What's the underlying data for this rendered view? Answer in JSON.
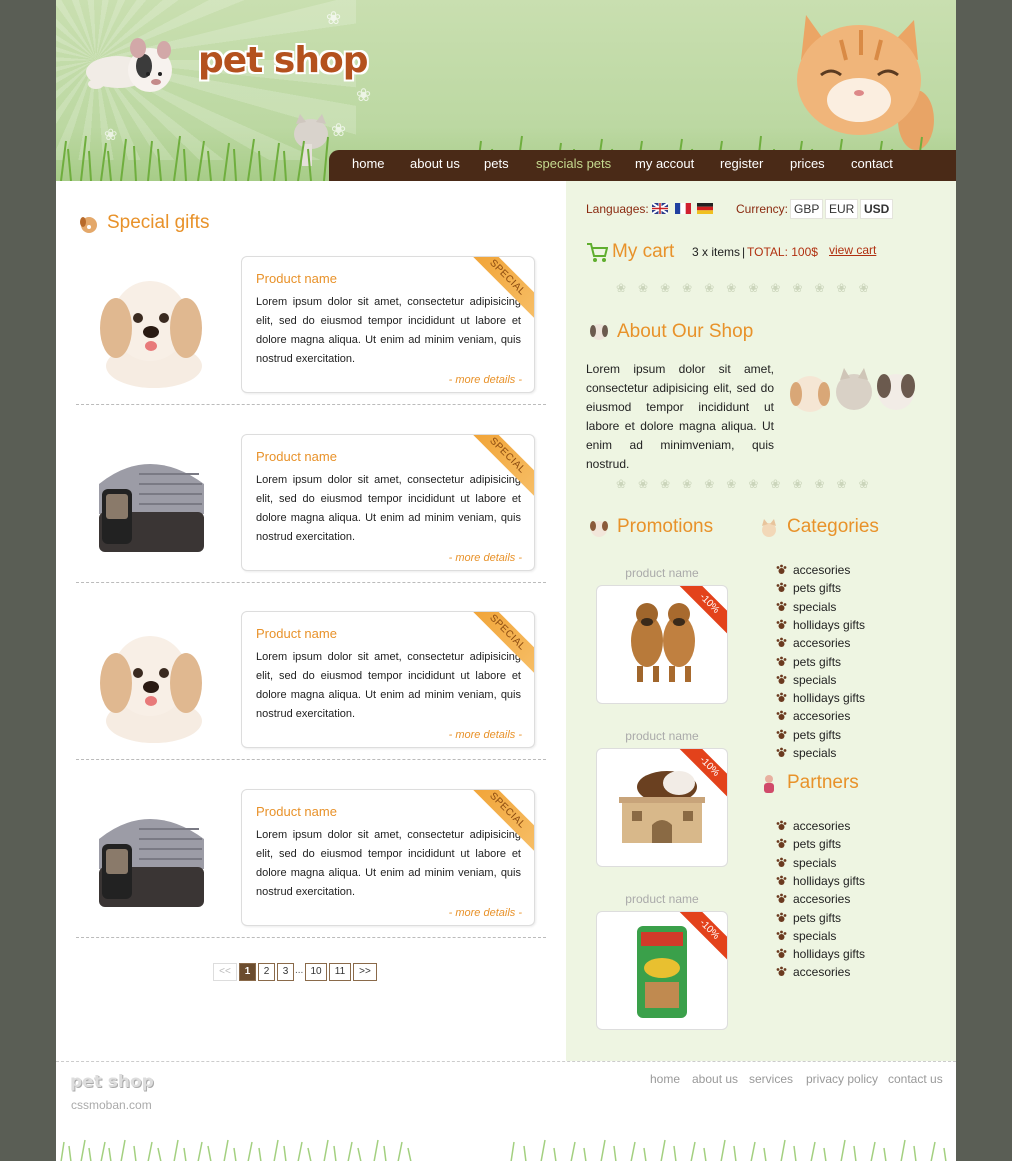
{
  "header": {
    "logo": "pet shop",
    "nav": [
      "home",
      "about us",
      "pets",
      "specials pets",
      "my accout",
      "register",
      "prices",
      "contact"
    ],
    "active_nav": "specials pets"
  },
  "special_gifts": {
    "title": "Special gifts",
    "products": [
      {
        "name": "Product name",
        "desc": "Lorem ipsum dolor sit amet, consectetur adipisicing elit, sed do eiusmod tempor incididunt ut labore et dolore magna aliqua. Ut enim ad minim veniam, quis nostrud exercitation.",
        "more": "- more details -",
        "badge": "SPECIAL",
        "image": "puppy"
      },
      {
        "name": "Product name",
        "desc": "Lorem ipsum dolor sit amet, consectetur adipisicing elit, sed do eiusmod tempor incididunt ut labore et dolore magna aliqua. Ut enim ad minim veniam, quis nostrud exercitation.",
        "more": "- more details -",
        "badge": "SPECIAL",
        "image": "pet-carrier"
      },
      {
        "name": "Product name",
        "desc": "Lorem ipsum dolor sit amet, consectetur adipisicing elit, sed do eiusmod tempor incididunt ut labore et dolore magna aliqua. Ut enim ad minim veniam, quis nostrud exercitation.",
        "more": "- more details -",
        "badge": "SPECIAL",
        "image": "puppy"
      },
      {
        "name": "Product name",
        "desc": "Lorem ipsum dolor sit amet, consectetur adipisicing elit, sed do eiusmod tempor incididunt ut labore et dolore magna aliqua. Ut enim ad minim veniam, quis nostrud exercitation.",
        "more": "- more details -",
        "badge": "SPECIAL",
        "image": "pet-carrier"
      }
    ],
    "pager": {
      "prev": "<<",
      "pages": [
        "1",
        "2",
        "3"
      ],
      "ellipsis": "...",
      "tail": [
        "10",
        "11"
      ],
      "next": ">>",
      "current": "1"
    }
  },
  "toolbar": {
    "languages_label": "Languages:",
    "currency_label": "Currency:",
    "currencies": [
      "GBP",
      "EUR",
      "USD"
    ],
    "active_currency": "USD"
  },
  "cart": {
    "title": "My cart",
    "items": "3 x items",
    "sep": "|",
    "total": "TOTAL: 100$",
    "link": "view cart"
  },
  "about": {
    "title": "About Our Shop",
    "text": "Lorem ipsum dolor sit amet, consectetur adipisicing elit, sed do eiusmod tempor incididunt ut labore et dolore magna aliqua. Ut enim ad minimveniam, quis nostrud."
  },
  "promotions": {
    "title": "Promotions",
    "items": [
      {
        "name": "product name",
        "badge": "-10%",
        "image": "puppies"
      },
      {
        "name": "product name",
        "badge": "-10%",
        "image": "guinea-pig-house"
      },
      {
        "name": "product name",
        "badge": "-10%",
        "image": "pet-food-bag"
      }
    ]
  },
  "categories": {
    "title": "Categories",
    "items": [
      "accesories",
      "pets gifts",
      "specials",
      "hollidays gifts",
      "accesories",
      "pets gifts",
      "specials",
      "hollidays gifts",
      "accesories",
      "pets gifts",
      "specials"
    ]
  },
  "partners": {
    "title": "Partners",
    "items": [
      "accesories",
      "pets gifts",
      "specials",
      "hollidays gifts",
      "accesories",
      "pets gifts",
      "specials",
      "hollidays gifts",
      "accesories"
    ]
  },
  "footer": {
    "logo": "pet shop",
    "sub": "cssmoban.com",
    "nav": [
      "home",
      "about us",
      "services",
      "privacy policy",
      "contact us"
    ]
  },
  "colors": {
    "accent": "#e8922a",
    "nav_bg": "#4a2a17",
    "header_green": "#c9dfb0",
    "sidebar_bg": "#eef5e2",
    "promo_badge": "#e3421b"
  }
}
